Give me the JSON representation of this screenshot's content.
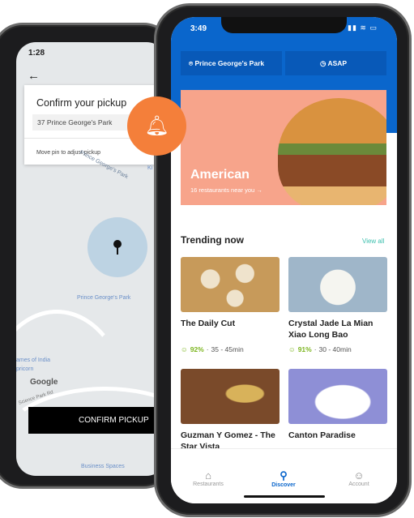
{
  "back_phone": {
    "time": "1:28",
    "title": "Confirm your pickup",
    "address": "37 Prince George's Park",
    "hint": "Move pin to adjust pickup",
    "map_labels": [
      "Prince George's Park",
      "Prince George's Park",
      "ames of India",
      "pricorn",
      "Science Park Rd",
      "Business Spaces",
      "Ki"
    ],
    "google_label": "Google",
    "confirm_label": "CONFIRM PICKUP"
  },
  "badge": {
    "icon": "bell-icon",
    "color": "#f47f3a"
  },
  "front_phone": {
    "time": "3:49",
    "location": "Prince George's Park",
    "timing": "ASAP",
    "brand_color": "#0a66cc",
    "banner": {
      "title": "American",
      "subtitle": "16 restaurants near you",
      "color": "#f7a48b"
    },
    "section_title": "Trending now",
    "view_all": "View all",
    "restaurants": [
      {
        "name": "The Daily Cut",
        "rating": "92%",
        "time": "35 - 45min"
      },
      {
        "name": "Crystal Jade La Mian Xiao Long Bao",
        "rating": "91%",
        "time": "30 - 40min"
      },
      {
        "name": "Guzman Y Gomez - The Star Vista"
      },
      {
        "name": "Canton Paradise"
      }
    ],
    "nav": [
      {
        "label": "Restaurants",
        "icon": "home-icon"
      },
      {
        "label": "Discover",
        "icon": "search-icon",
        "active": true
      },
      {
        "label": "Account",
        "icon": "user-icon"
      }
    ]
  }
}
